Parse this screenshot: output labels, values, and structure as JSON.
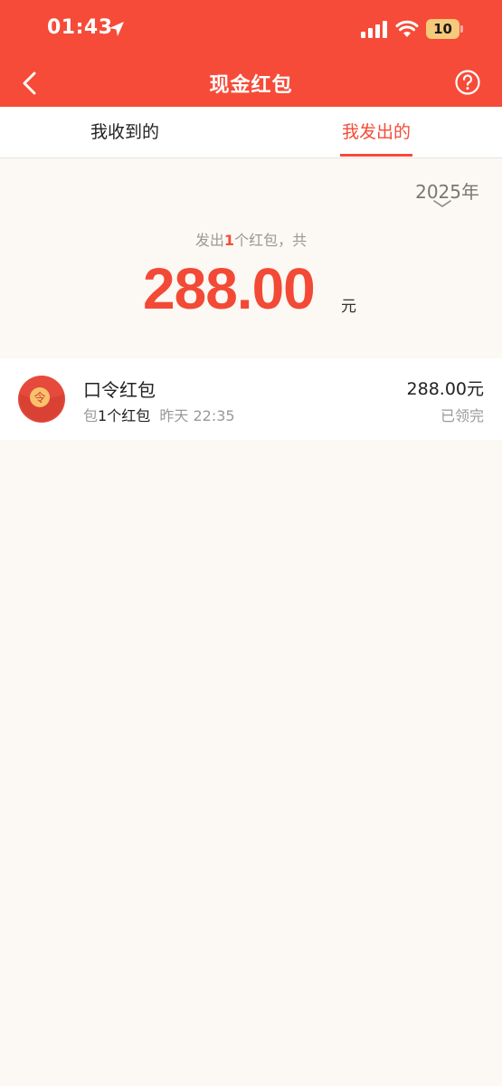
{
  "status_bar": {
    "time": "01:43",
    "battery": "10",
    "icons": [
      "location-arrow-icon",
      "cellular-signal-icon",
      "wifi-icon",
      "battery-icon"
    ]
  },
  "nav": {
    "title": "现金红包",
    "back_icon": "chevron-left-icon",
    "help_icon": "question-circle-icon"
  },
  "tabs": [
    {
      "label": "我收到的",
      "active": false
    },
    {
      "label": "我发出的",
      "active": true
    }
  ],
  "year_filter": {
    "label": "2025年",
    "icon": "chevron-down-icon"
  },
  "summary": {
    "prefix": "发出",
    "count": "1",
    "suffix": "个红包，共",
    "total": "288.00",
    "unit": "元"
  },
  "records": [
    {
      "title": "口令红包",
      "avatar_icon": "red-packet-icon",
      "avatar_glyph": "令",
      "sub_prefix": "包",
      "sub_count": "1个红包",
      "date": "昨天 22:35",
      "amount": "288.00元",
      "status": "已领完"
    }
  ],
  "colors": {
    "brand_red": "#f64b38",
    "page_bg": "#fcf8f3",
    "muted_text": "#999999"
  }
}
